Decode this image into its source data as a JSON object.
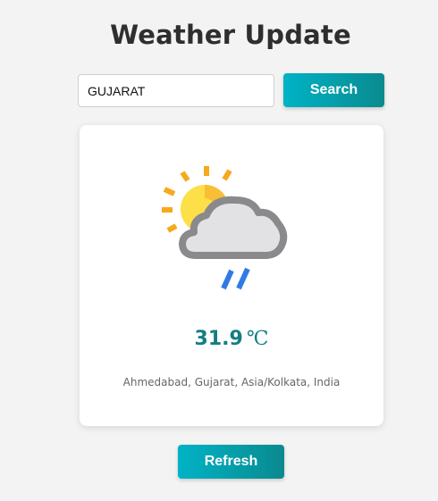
{
  "header": {
    "title": "Weather Update"
  },
  "search": {
    "value": "GUJARAT",
    "button_label": "Search"
  },
  "weather": {
    "icon": "partly-cloudy-rain-icon",
    "temperature_value": "31.9",
    "temperature_unit": "℃",
    "location": "Ahmedabad, Gujarat, Asia/Kolkata, India"
  },
  "actions": {
    "refresh_label": "Refresh"
  },
  "colors": {
    "accent_start": "#00b3c6",
    "accent_end": "#0a8a8f",
    "temperature": "#137e83",
    "background": "#f3f3f3",
    "card": "#ffffff"
  }
}
